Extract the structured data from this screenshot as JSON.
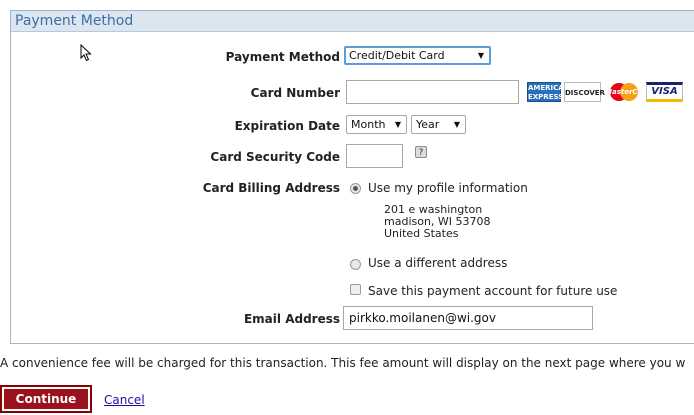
{
  "panel": {
    "title": "Payment Method"
  },
  "form": {
    "payment_method_label": "Payment Method",
    "payment_method_value": "Credit/Debit Card",
    "card_number_label": "Card Number",
    "card_number_value": "",
    "card_logos": [
      "AMERICAN EXPRESS",
      "DISCOVER",
      "MasterCard",
      "VISA"
    ],
    "expiration_label": "Expiration Date",
    "month_value": "Month",
    "year_value": "Year",
    "security_label": "Card Security Code",
    "security_value": "",
    "billing_label": "Card Billing Address",
    "use_profile_label": "Use my profile information",
    "address_line1": "201 e washington",
    "address_line2": "madison, WI 53708",
    "address_line3": "United States",
    "different_address_label": "Use a different address",
    "save_account_label": "Save this payment account for future use",
    "email_label": "Email Address",
    "email_value": "pirkko.moilanen@wi.gov"
  },
  "footer": {
    "fee_note": "A convenience fee will be charged for this transaction. This fee amount will display on the next page where you w",
    "continue_label": "Continue",
    "cancel_label": "Cancel"
  },
  "colors": {
    "header_bg": "#dbe6f1",
    "header_text": "#3e6fa0",
    "continue_bg": "#9b111e",
    "link": "#1a0dab"
  }
}
